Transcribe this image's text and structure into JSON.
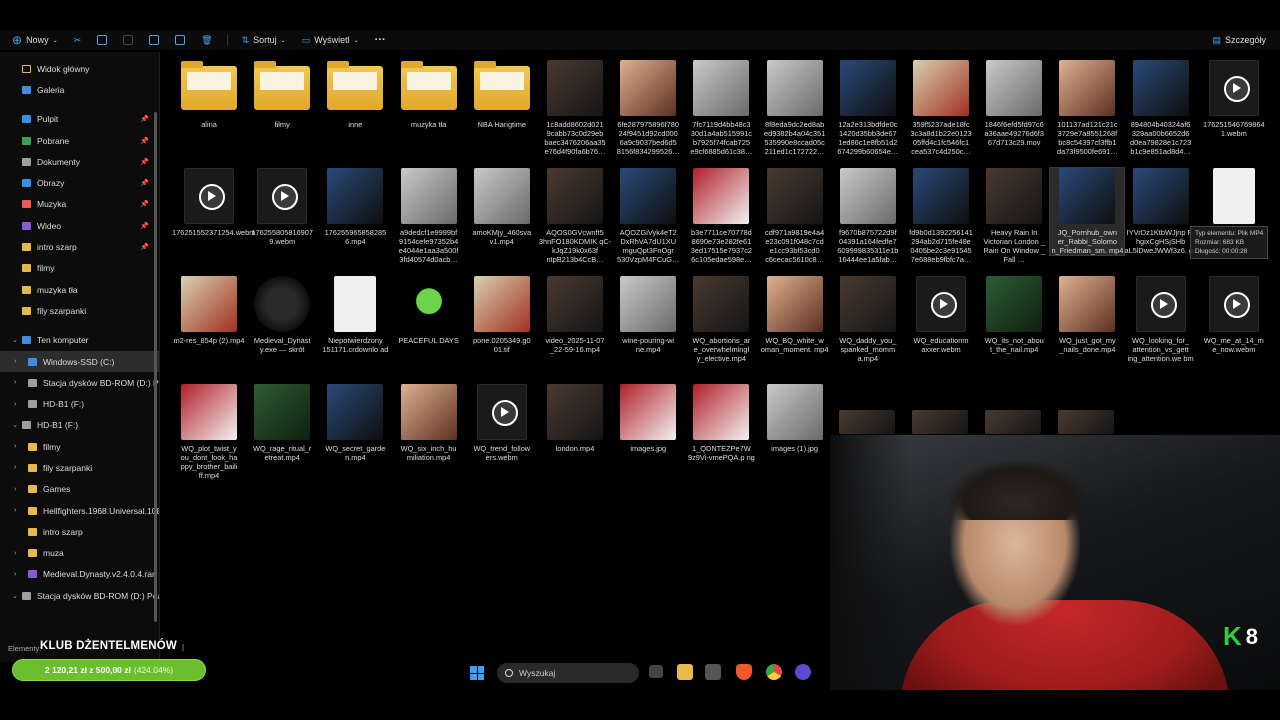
{
  "toolbar": {
    "new_label": "Nowy",
    "sort_label": "Sortuj",
    "view_label": "Wyświetl",
    "more_label": "···",
    "details_label": "Szczegóły"
  },
  "sidebar": {
    "home": "Widok główny",
    "gallery": "Galeria",
    "desktop": "Pulpit",
    "downloads": "Pobrane",
    "documents": "Dokumenty",
    "pictures": "Obrazy",
    "music": "Muzyka",
    "videos": "Wideo",
    "intro1": "intro szarp",
    "filmy1": "filmy",
    "muzyka_tla": "muzyka tła",
    "fily1": "fily szarpanki",
    "computer": "Ten komputer",
    "windows_ssd": "Windows-SSD (C:)",
    "bdrom_d": "Stacja dysków BD-ROM (D:) Pe",
    "hdb1_f": "HD-B1 (F:)",
    "hdb1_f2": "HD-B1 (F:)",
    "filmy2": "filmy",
    "fily2": "fily szarpanki",
    "games": "Games",
    "hellfighters": "Hellfighters.1968.Universal.108",
    "intro2": "intro szarp",
    "muza": "muza",
    "medieval_rar": "Medieval.Dynasty.v2.4.0.4.rar",
    "bdrom_d2": "Stacja dysków BD-ROM (D:) Pea"
  },
  "files": {
    "r1": [
      "alina",
      "filmy",
      "inne",
      "muzyka tła",
      "NBA Hangtime",
      "1c8add8602d021 9cabb73c0d29eb baec3476206aa35 e76d4f90fa6b76…",
      "6fe287975896f780 24f9451d92cd000 6a9c9037bed6d5 8156f834299526…",
      "7fc7119d4bb48c3 30d1a4ab515991c b7925f74fcab725 e9cf6885d61c38…",
      "8f8eda9dc2ed8ab ed9382b4a04c351 535990e8ccad05c 211ed1c172722…",
      "12a2e313bdfde0c 1420d35bb3de67 1ed86c1e8fb51d2 674299b60654e…",
      "359f5237ade18fc 3c3a8d1b22e0123 05ffd4c1fc546fc1 cea537c4d250c…",
      "1846f6efd5fd97c6 a36aae49276d6f3 67d713c29.mov",
      "101137ad121c21c 3729e7a8551268f bc8c54397cf3ffb1 da73f9500fe691…",
      "894804b40324af6 329aa00b6652d6 d0ea79828e1c723 b1c9e851ad8d4…",
      "176251546769864 1.webm"
    ],
    "r2": [
      "176251552371254.webm",
      "176255805816907 9.webm",
      "176255965858285 6.mp4",
      "a9dedcf1e9999bf 9154cefe97352b4 e4044e1aa3a500f 3fd40574d0acb…",
      "amoKMjy_460sva v1.mp4",
      "AQOS0GVcwnft5 3hnFO180KDMIK qC-kJqZ19k0x63f ntpB213b4CcB…",
      "AQOZGiVyk4eT2 DxRhVA7dU1XU mguQpt3FnOgr 530VzpM4FCuG…",
      "b3e7711ce70778d 8690e73e282fe61 3ed17515e7937c2 6c105edae598e…",
      "cdf971a9819e4a4 e23c091f048c7cd e1cc93bf53cd0 c6cecac5610c8…",
      "f9670b875722d9f 04391a164fedfe7 609999835311e1b 16444ee1a5fab…",
      "fd9b0d1392256141 294ab2d715fe48e 0405be2c3e91545 7e688eb9fbfc7a…",
      "Heavy Rain In Victorian London _ Rain On Window _ Fall …",
      "JQ_Pornhub_own er_Rabbi_Solomo n_Friedman_sm. mp4",
      "IYVrDz1KtbWJjnp F-hgixCgHSjSHb aL5lDweJWWf3z6. gif",
      ""
    ],
    "r3": [
      "m2-res_854p (2).mp4",
      "Medieval_Dynast y.exe — skrót",
      "Niepotwierdzony 151171.crdownlo ad",
      "PEACEFUL DAYS",
      "pone.0205349.g0 01.tif",
      "video_2025-11-07 _22-59-16.mp4",
      "wine-pouring-wi ne.mp4",
      "WQ_abortions_ar e_overwhelmingl y_elective.mp4",
      "WQ_BQ_white_w oman_moment. mp4",
      "WQ_daddy_you_ spanked_momm a.mp4",
      "WQ_educationm axxer.webm",
      "WQ_its_not_abou t_the_nail.mp4",
      "WQ_just_got_my _nails_done.mp4",
      "WQ_looking_for_ attention_vs_gett ing_attention.we bm",
      "WQ_me_at_14_m e_now.webm"
    ],
    "r4": [
      "WQ_plot_twist_y ou_dont_look_ha ppy_brother_baili ff.mp4",
      "WQ_rage_ritual_r etreat.mp4",
      "WQ_secret_garde n.mp4",
      "WQ_six_inch_hu miliation.mp4",
      "WQ_trend_follow ers.webm",
      "london.mp4",
      "images.jpg",
      "1_QDNTEZPe7W 9z9Vi-vmePQA.p ng",
      "images (1).jpg"
    ]
  },
  "tooltip": {
    "line1": "Typ elementu: Plik MP4",
    "line2": "Rozmiar: 683 KB",
    "line3": "Długość: 00:00:28"
  },
  "overlay": {
    "elements": "Elementy:",
    "title": "KLUB DŻENTELMENÓW",
    "tail": "|",
    "money": "2 120,21 zł z 500,00 zł",
    "percent": "(424.04%)",
    "badge_k": "K",
    "badge_num": "8"
  },
  "taskbar": {
    "search_placeholder": "Wyszukaj"
  },
  "colors": {
    "accent": "#3c8fe0",
    "folder": "#e7b84a",
    "money_bar": "#6bbf2e",
    "shirt": "#c62828"
  }
}
